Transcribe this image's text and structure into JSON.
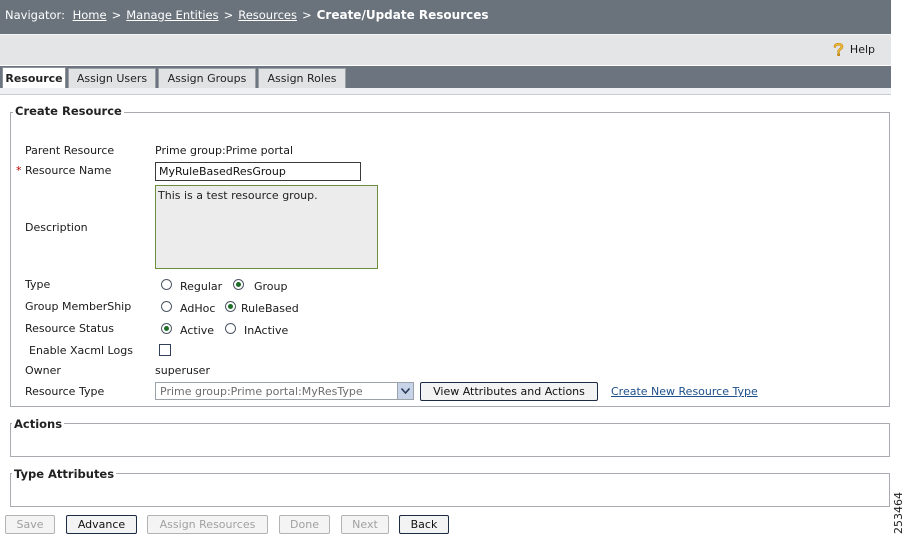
{
  "navigator": {
    "prefix": "Navigator:",
    "crumbs": [
      "Home",
      "Manage Entities",
      "Resources"
    ],
    "separator": ">",
    "current": "Create/Update Resources"
  },
  "help": {
    "label": "Help",
    "icon": "question-mark-icon"
  },
  "tabs": [
    {
      "label": "Resource",
      "active": true
    },
    {
      "label": "Assign Users",
      "active": false
    },
    {
      "label": "Assign Groups",
      "active": false
    },
    {
      "label": "Assign Roles",
      "active": false
    }
  ],
  "create_resource": {
    "legend": "Create Resource",
    "parent_resource": {
      "label": "Parent Resource",
      "value": "Prime group:Prime portal"
    },
    "resource_name": {
      "required_mark": "*",
      "label": "Resource Name",
      "value": "MyRuleBasedResGroup"
    },
    "description": {
      "label": "Description",
      "value": "This is a test resource group."
    },
    "type": {
      "label": "Type",
      "options": [
        "Regular",
        "Group"
      ],
      "selected": "Group"
    },
    "group_membership": {
      "label": "Group MemberShip",
      "options": [
        "AdHoc",
        "RuleBased"
      ],
      "selected": "RuleBased"
    },
    "resource_status": {
      "label": "Resource Status",
      "options": [
        "Active",
        "InActive"
      ],
      "selected": "Active"
    },
    "enable_xacml_logs": {
      "label": "Enable Xacml Logs",
      "checked": false
    },
    "owner": {
      "label": "Owner",
      "value": "superuser"
    },
    "resource_type": {
      "label": "Resource Type",
      "selected": "Prime group:Prime portal:MyResType",
      "view_button": "View Attributes and Actions",
      "create_link": "Create New Resource Type"
    }
  },
  "actions_section": {
    "legend": "Actions"
  },
  "type_attributes_section": {
    "legend": "Type Attributes"
  },
  "footer_buttons": [
    {
      "label": "Save",
      "enabled": false
    },
    {
      "label": "Advance",
      "enabled": true
    },
    {
      "label": "Assign Resources",
      "enabled": false
    },
    {
      "label": "Done",
      "enabled": false
    },
    {
      "label": "Next",
      "enabled": false
    },
    {
      "label": "Back",
      "enabled": true
    }
  ],
  "figure_id": "253464",
  "colors": {
    "nav_bg": "#6a727c",
    "help_bar_bg": "#e4e5e7",
    "required": "#c00000",
    "link": "#1d4f8a",
    "radio_dot": "#1e6e2a"
  }
}
